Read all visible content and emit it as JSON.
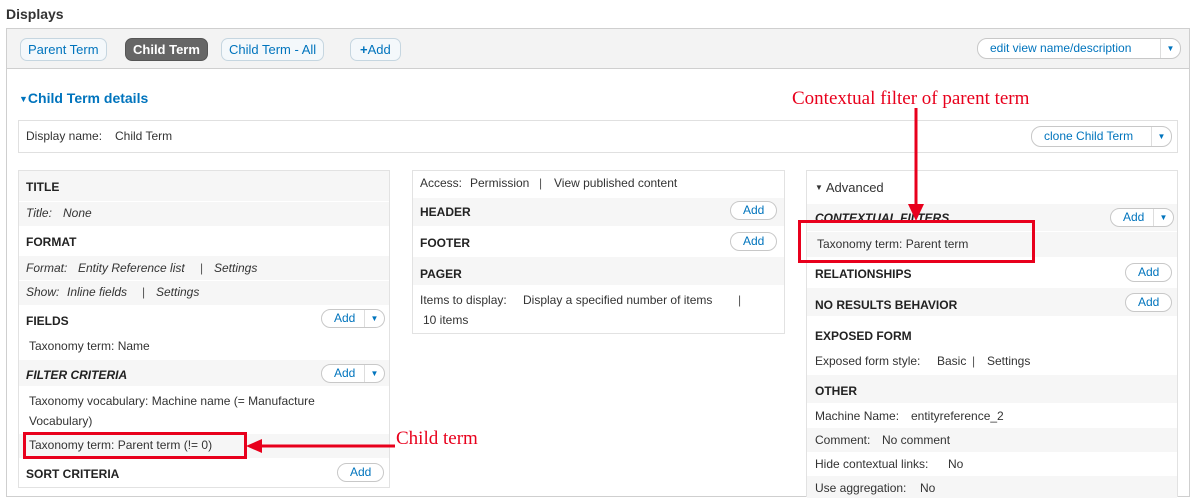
{
  "page": {
    "title": "Displays"
  },
  "tabs": [
    {
      "label": "Parent Term",
      "active": false
    },
    {
      "label": "Child Term",
      "active": true
    },
    {
      "label": "Child Term - All",
      "active": false
    },
    {
      "label": "Add",
      "icon": "plus-icon"
    }
  ],
  "edit_view_label": "edit view name/description",
  "details": {
    "title": "Child Term details",
    "display_name_label": "Display name:",
    "display_name_value": "Child Term",
    "clone_label": "clone Child Term"
  },
  "left": {
    "title_header": "TITLE",
    "title_label": "Title:",
    "title_value": "None",
    "format_header": "FORMAT",
    "format_label": "Format:",
    "format_value": "Entity Reference list",
    "format_settings": "Settings",
    "show_label": "Show:",
    "show_value": "Inline fields",
    "show_settings": "Settings",
    "fields_header": "FIELDS",
    "fields_add": "Add",
    "field_item": "Taxonomy term: Name",
    "filter_header": "FILTER CRITERIA",
    "filter_add": "Add",
    "filter_item_1_line1": "Taxonomy vocabulary: Machine name (= Manufacture",
    "filter_item_1_line2": "Vocabulary)",
    "filter_item_2": "Taxonomy term: Parent term (!= 0)",
    "sort_header": "SORT CRITERIA",
    "sort_add": "Add"
  },
  "middle": {
    "access_label": "Access:",
    "access_value": "Permission",
    "access_value_2": "View published content",
    "header_header": "HEADER",
    "header_add": "Add",
    "footer_header": "FOOTER",
    "footer_add": "Add",
    "pager_header": "PAGER",
    "pager_label": "Items to display:",
    "pager_value": "Display a specified number of items",
    "pager_count": "10 items"
  },
  "right": {
    "advanced_label": "Advanced",
    "contextual_header": "CONTEXTUAL FILTERS",
    "contextual_add": "Add",
    "contextual_item": "Taxonomy term: Parent term",
    "relationships_header": "RELATIONSHIPS",
    "relationships_add": "Add",
    "noresults_header": "NO RESULTS BEHAVIOR",
    "noresults_add": "Add",
    "exposed_header": "EXPOSED FORM",
    "exposed_label": "Exposed form style:",
    "exposed_value": "Basic",
    "exposed_settings": "Settings",
    "other_header": "OTHER",
    "machine_label": "Machine Name:",
    "machine_value": "entityreference_2",
    "comment_label": "Comment:",
    "comment_value": "No comment",
    "hide_label": "Hide contextual links:",
    "hide_value": "No",
    "agg_label": "Use aggregation:",
    "agg_value": "No"
  },
  "annotations": {
    "contextual": "Contextual filter of parent term",
    "child": "Child term",
    "color": "#e8001c"
  },
  "icons": {
    "separator": "|",
    "triangle": "▼"
  }
}
